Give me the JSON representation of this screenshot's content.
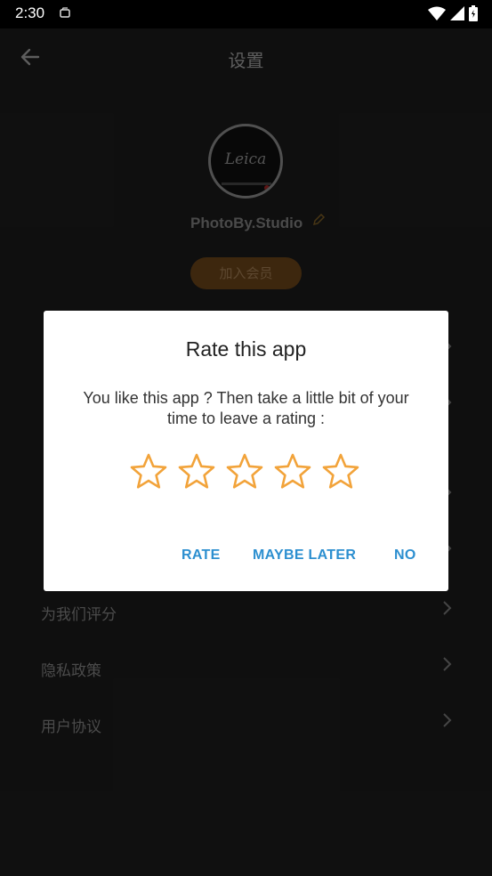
{
  "status_bar": {
    "time": "2:30"
  },
  "header": {
    "title": "设置"
  },
  "profile": {
    "avatar_text": "Leica",
    "name": "PhotoBy.Studio",
    "member_button": "加入会员"
  },
  "menu": {
    "items": [
      {
        "label": ""
      },
      {
        "label": ""
      },
      {
        "label": ""
      },
      {
        "label": ""
      },
      {
        "label": "为我们评分"
      },
      {
        "label": "隐私政策"
      },
      {
        "label": "用户协议"
      }
    ]
  },
  "dialog": {
    "title": "Rate this app",
    "message": "You like this app ? Then take a little bit of your time to leave a rating :",
    "rating": 0,
    "rating_max": 5,
    "buttons": {
      "rate": "RATE",
      "later": "MAYBE LATER",
      "no": "NO"
    }
  },
  "colors": {
    "accent": "#2c8fd0",
    "star": "#f2a33a",
    "member": "#5b3a15"
  }
}
